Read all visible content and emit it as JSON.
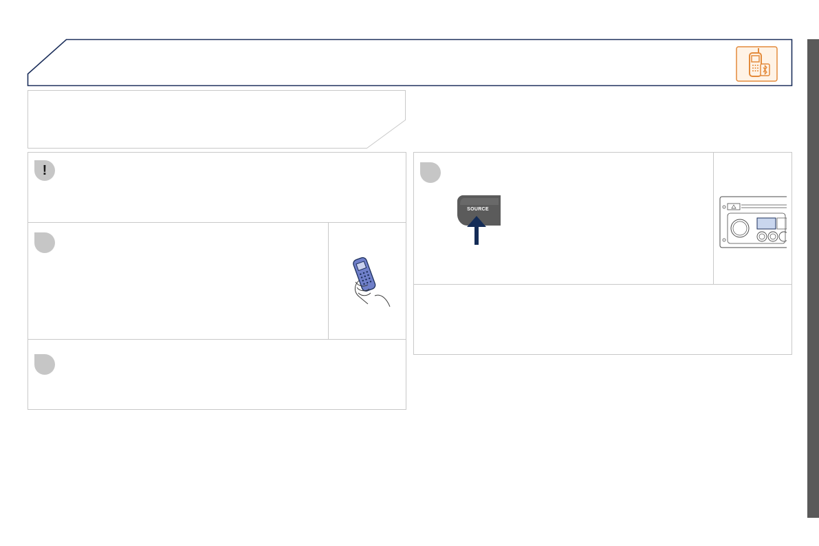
{
  "icons": {
    "header": "phone-bluetooth-icon",
    "warning": "exclamation-icon",
    "phone_in_hand": "phone-in-hand-icon",
    "radio_unit": "radio-unit-icon",
    "source_button": "source-button-icon",
    "press_arrow": "arrow-up-icon"
  },
  "warning": {
    "symbol": "!"
  },
  "source_button": {
    "label": "SOURCE"
  },
  "colors": {
    "header_border": "#1b2e5a",
    "icon_orange": "#e38a3a",
    "bullet_gray": "#c6c6c6",
    "panel_border": "#c8c8c8",
    "side_bar": "#5a5a5a",
    "arrow_navy": "#142c57"
  }
}
